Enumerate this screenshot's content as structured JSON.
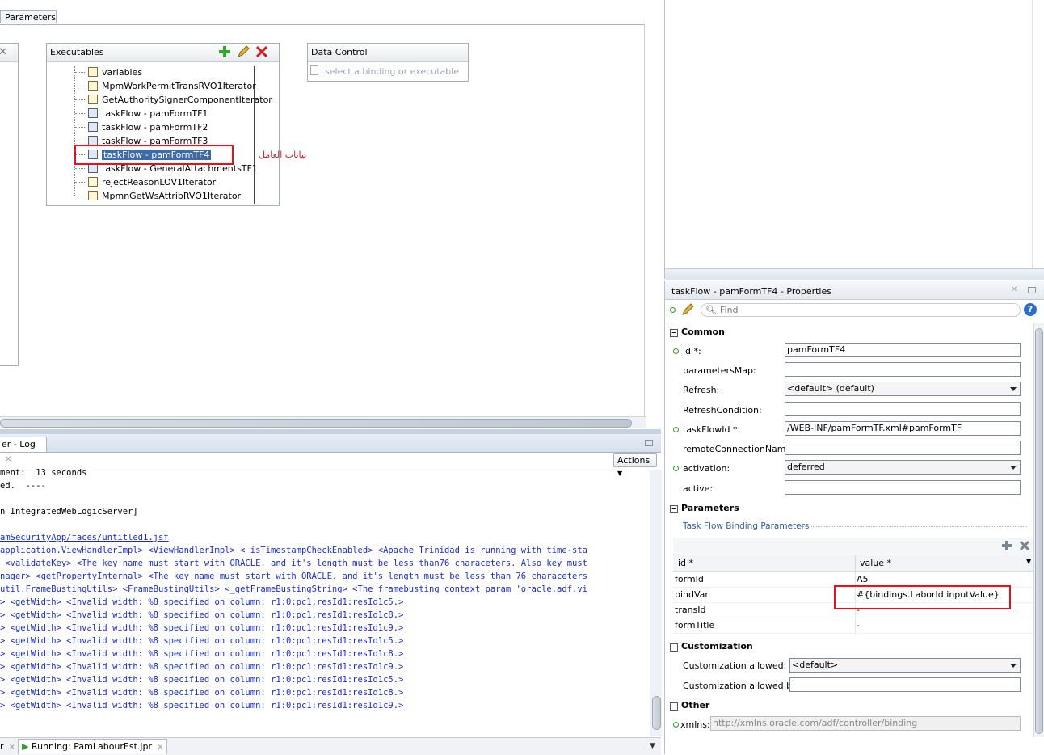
{
  "editor": {
    "tab_label": "Parameters",
    "executables": {
      "title": "Executables",
      "items": [
        {
          "label": "variables",
          "icon": "iterator-icon"
        },
        {
          "label": "MpmWorkPermitTransRVO1Iterator",
          "icon": "iterator-icon"
        },
        {
          "label": "GetAuthoritySignerComponentIterator",
          "icon": "iterator-icon"
        },
        {
          "label": "taskFlow - pamFormTF1",
          "icon": "taskflow-icon"
        },
        {
          "label": "taskFlow - pamFormTF2",
          "icon": "taskflow-icon"
        },
        {
          "label": "taskFlow - pamFormTF3",
          "icon": "taskflow-icon"
        },
        {
          "label": "taskFlow - pamFormTF4",
          "icon": "taskflow-icon",
          "selected": true
        },
        {
          "label": "taskFlow - GeneralAttachmentsTF1",
          "icon": "taskflow-icon"
        },
        {
          "label": "rejectReasonLOV1Iterator",
          "icon": "iterator-icon"
        },
        {
          "label": "MpmnGetWsAttribRVO1Iterator",
          "icon": "iterator-icon"
        }
      ]
    },
    "data_control": {
      "title": "Data Control",
      "placeholder": "select a binding or executable"
    },
    "annotation_arabic": "بيانات العامل"
  },
  "log": {
    "tab_label": "er - Log",
    "actions_label": "Actions",
    "lines": [
      {
        "text": "ment:  13 seconds",
        "color": "black"
      },
      {
        "text": "ed.  ----",
        "color": "black"
      },
      {
        "text": "",
        "color": "black"
      },
      {
        "text": "n IntegratedWebLogicServer]",
        "color": "black"
      },
      {
        "text": "",
        "color": "black"
      },
      {
        "text": "amSecurityApp/faces/untitled1.jsf",
        "color": "blue",
        "underline": true
      },
      {
        "text": "application.ViewHandlerImpl> <ViewHandlerImpl> <_isTimestampCheckEnabled> <Apache Trinidad is running with time-sta",
        "color": "blue"
      },
      {
        "text": " <validateKey> <The key name must start with ORACLE. and it's length must be less than76 characeters. Also key must",
        "color": "blue"
      },
      {
        "text": "nager> <getPropertyInternal> <The key name must start with ORACLE. and it's length must be less than 76 characeters",
        "color": "blue"
      },
      {
        "text": "util.FrameBustingUtils> <FrameBustingUtils> <_getFrameBustingString> <The framebusting context param 'oracle.adf.vi",
        "color": "blue"
      },
      {
        "text": "> <getWidth> <Invalid width: %8 specified on column: r1:0:pc1:resId1:resId1c5.>",
        "color": "blue"
      },
      {
        "text": "> <getWidth> <Invalid width: %8 specified on column: r1:0:pc1:resId1:resId1c8.>",
        "color": "blue"
      },
      {
        "text": "> <getWidth> <Invalid width: %8 specified on column: r1:0:pc1:resId1:resId1c9.>",
        "color": "blue"
      },
      {
        "text": "> <getWidth> <Invalid width: %8 specified on column: r1:0:pc1:resId1:resId1c5.>",
        "color": "blue"
      },
      {
        "text": "> <getWidth> <Invalid width: %8 specified on column: r1:0:pc1:resId1:resId1c8.>",
        "color": "blue"
      },
      {
        "text": "> <getWidth> <Invalid width: %8 specified on column: r1:0:pc1:resId1:resId1c9.>",
        "color": "blue"
      },
      {
        "text": "> <getWidth> <Invalid width: %8 specified on column: r1:0:pc1:resId1:resId1c5.>",
        "color": "blue"
      },
      {
        "text": "> <getWidth> <Invalid width: %8 specified on column: r1:0:pc1:resId1:resId1c8.>",
        "color": "blue"
      },
      {
        "text": "> <getWidth> <Invalid width: %8 specified on column: r1:0:pc1:resId1:resId1c9.>",
        "color": "blue"
      }
    ]
  },
  "status_tabs": {
    "first_label": "r",
    "running_label": "Running: PamLabourEst.jpr"
  },
  "properties": {
    "title": "taskFlow - pamFormTF4 - Properties",
    "find_placeholder": "Find",
    "common": {
      "section": "Common",
      "id_label": "id *:",
      "id_value": "pamFormTF4",
      "parametersMap_label": "parametersMap:",
      "parametersMap_value": "",
      "refresh_label": "Refresh:",
      "refresh_value": "<default> (default)",
      "refreshCondition_label": "RefreshCondition:",
      "refreshCondition_value": "",
      "taskFlowId_label": "taskFlowId *:",
      "taskFlowId_value": "/WEB-INF/pamFormTF.xml#pamFormTF",
      "remoteConnectionName_label": "remoteConnectionName:",
      "remoteConnectionName_value": "",
      "activation_label": "activation:",
      "activation_value": "deferred",
      "active_label": "active:",
      "active_value": ""
    },
    "parameters": {
      "section": "Parameters",
      "subsection": "Task Flow Binding Parameters",
      "col_id": "id *",
      "col_value": "value *",
      "rows": [
        {
          "id": "formId",
          "value": "A5"
        },
        {
          "id": "bindVar",
          "value": "#{bindings.LaborId.inputValue}"
        },
        {
          "id": "transId",
          "value": "-"
        },
        {
          "id": "formTitle",
          "value": "-"
        }
      ]
    },
    "customization": {
      "section": "Customization",
      "allowed_label": "Customization allowed:",
      "allowed_value": "<default>",
      "allowed_by_label": "Customization allowed by:",
      "allowed_by_value": ""
    },
    "other": {
      "section": "Other",
      "xmlns_label": "xmlns:",
      "xmlns_value": "http://xmlns.oracle.com/adf/controller/binding"
    }
  },
  "colors": {
    "highlight_box": "#e8111b",
    "selection": "#3d6ba8",
    "log_blue": "#1a2bd1",
    "annotation": "#d6202a"
  }
}
